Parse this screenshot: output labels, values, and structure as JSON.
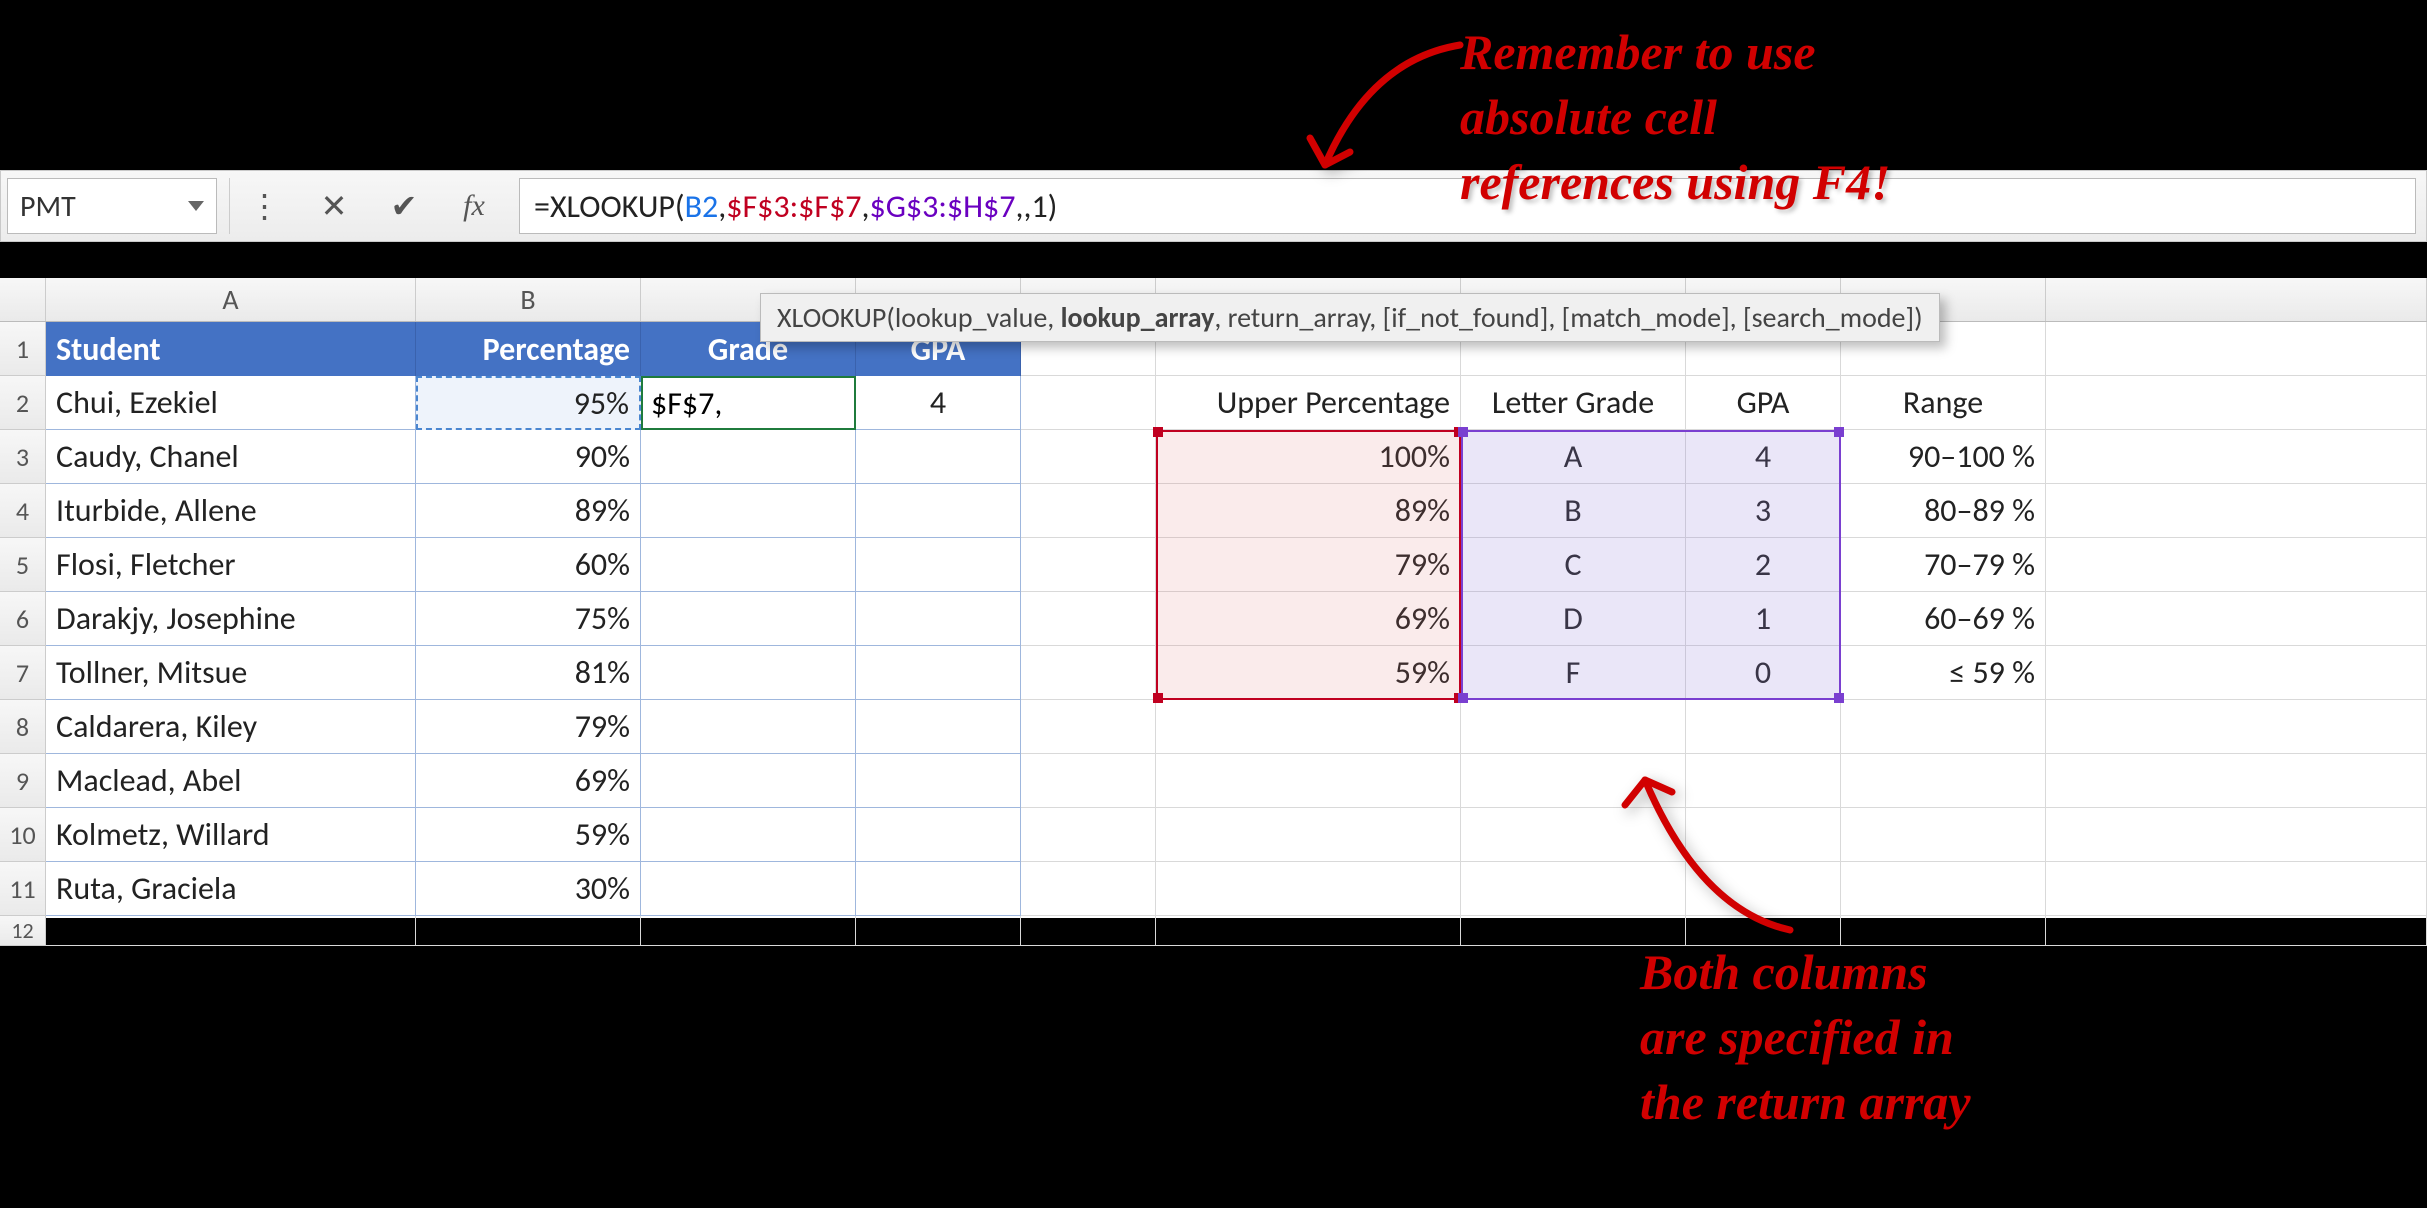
{
  "namebox": "PMT",
  "formula_parts": {
    "eq": "=",
    "fn": "XLOOKUP",
    "open": "(",
    "arg1": "B2",
    "c1": ",",
    "arg2": "$F$3:$F$7",
    "c2": ",",
    "arg3": "$G$3:$H$7",
    "c3": ",,",
    "arg5": "1",
    "close": ")"
  },
  "fn_tooltip": {
    "fn": "XLOOKUP(",
    "p1": "lookup_value, ",
    "p2_bold": "lookup_array",
    "p3": ", return_array, [if_not_found], [match_mode], [search_mode])"
  },
  "col_labels": {
    "A": "A",
    "B": "B"
  },
  "row_labels": [
    "1",
    "2",
    "3",
    "4",
    "5",
    "6",
    "7",
    "8",
    "9",
    "10",
    "11",
    "12"
  ],
  "headers": {
    "student": "Student",
    "percentage": "Percentage",
    "grade": "Grade",
    "gpa": "GPA"
  },
  "students": [
    {
      "name": "Chui, Ezekiel",
      "pct": "95%",
      "grade_editing": "$F$7,",
      "gpa": "4"
    },
    {
      "name": "Caudy, Chanel",
      "pct": "90%"
    },
    {
      "name": "Iturbide, Allene",
      "pct": "89%"
    },
    {
      "name": "Flosi, Fletcher",
      "pct": "60%"
    },
    {
      "name": "Darakjy, Josephine",
      "pct": "75%"
    },
    {
      "name": "Tollner, Mitsue",
      "pct": "81%"
    },
    {
      "name": "Caldarera, Kiley",
      "pct": "79%"
    },
    {
      "name": "Maclead, Abel",
      "pct": "69%"
    },
    {
      "name": "Kolmetz, Willard",
      "pct": "59%"
    },
    {
      "name": "Ruta, Graciela",
      "pct": "30%"
    }
  ],
  "lookup_headers": {
    "upper": "Upper Percentage",
    "grade": "Letter Grade",
    "gpa": "GPA",
    "range": "Range"
  },
  "lookup": [
    {
      "upper": "100%",
      "grade": "A",
      "gpa": "4",
      "range": "90–100 %"
    },
    {
      "upper": "89%",
      "grade": "B",
      "gpa": "3",
      "range": "80–89 %"
    },
    {
      "upper": "79%",
      "grade": "C",
      "gpa": "2",
      "range": "70–79 %"
    },
    {
      "upper": "69%",
      "grade": "D",
      "gpa": "1",
      "range": "60–69 %"
    },
    {
      "upper": "59%",
      "grade": "F",
      "gpa": "0",
      "range": "≤ 59 %"
    }
  ],
  "annotations": {
    "top": "Remember to use\nabsolute cell\nreferences using F4!",
    "bottom": "Both columns\nare specified in\nthe return array"
  },
  "icons": {
    "cancel": "✕",
    "confirm": "✔",
    "fx": "fx",
    "dots": "⋮"
  }
}
